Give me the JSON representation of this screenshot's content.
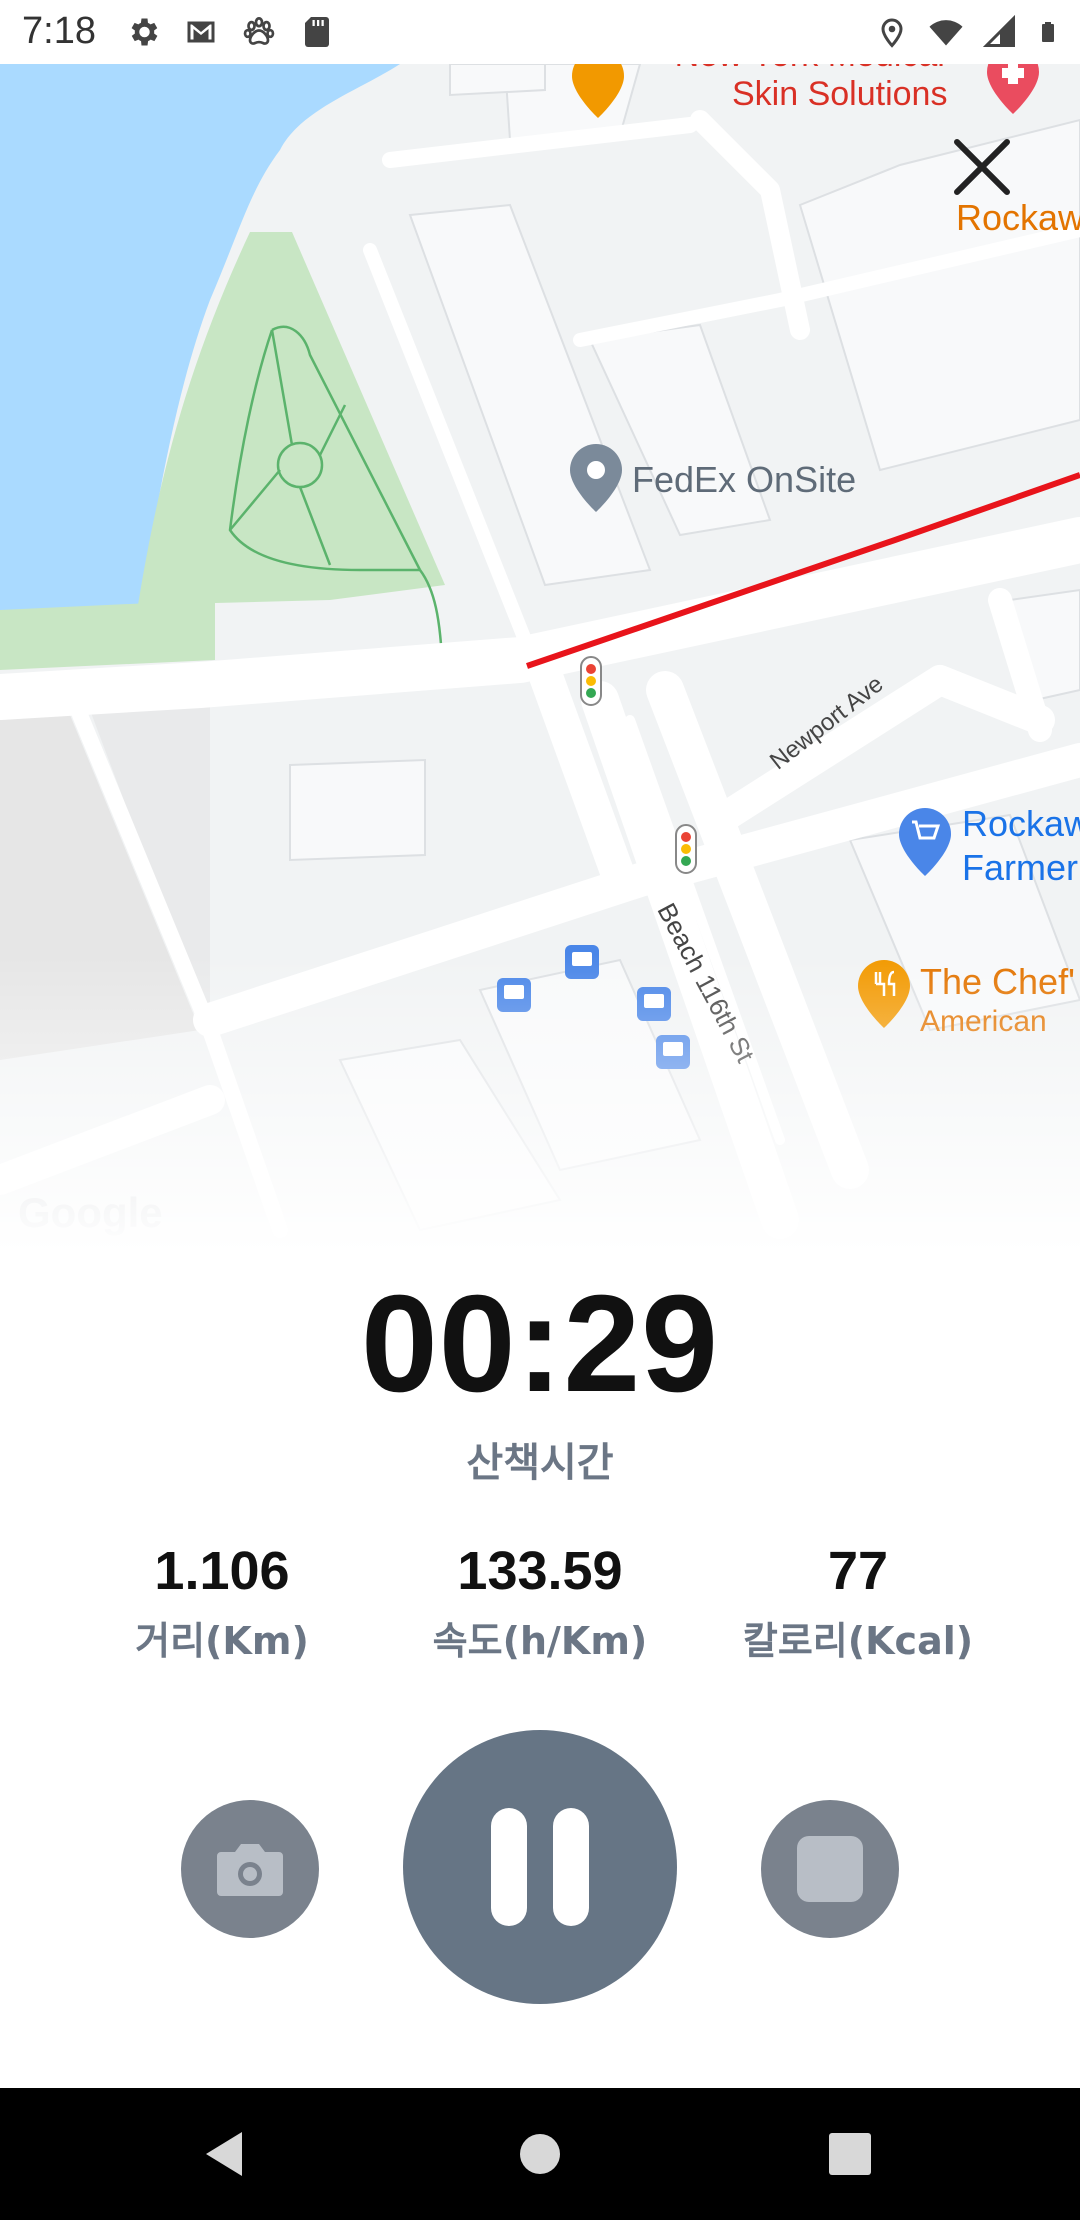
{
  "status_bar": {
    "time": "7:18",
    "left_icons": [
      "settings-icon",
      "gmail-icon",
      "paw-icon",
      "sd-card-icon"
    ],
    "right_icons": [
      "location-icon",
      "wifi-icon",
      "cellular-icon",
      "battery-icon"
    ]
  },
  "map": {
    "labels": {
      "medical_line1": "New York Medical",
      "medical_line2": "Skin Solutions",
      "rockaway_top": "Rockaw",
      "fedex": "FedEx OnSite",
      "newport_ave": "Newport Ave",
      "beach_st": "Beach 116th St",
      "market_line1": "Rockaw",
      "market_line2": "Farmer",
      "chef_line1": "The Chef'",
      "chef_line2": "American",
      "google": "Google"
    },
    "route_color": "#e8141b",
    "water_color": "#aadaff",
    "park_color": "#c8e6c4"
  },
  "walk": {
    "time_value": "00:29",
    "time_label": "산책시간",
    "stats": [
      {
        "value": "1.106",
        "label": "거리(Km)"
      },
      {
        "value": "133.59",
        "label": "속도(h/Km)"
      },
      {
        "value": "77",
        "label": "칼로리(Kcal)"
      }
    ]
  },
  "controls": {
    "camera": "camera-icon",
    "pause": "pause-icon",
    "stop": "stop-icon"
  },
  "nav_bar": {
    "back": "back-icon",
    "home": "home-icon",
    "recents": "recents-icon"
  }
}
